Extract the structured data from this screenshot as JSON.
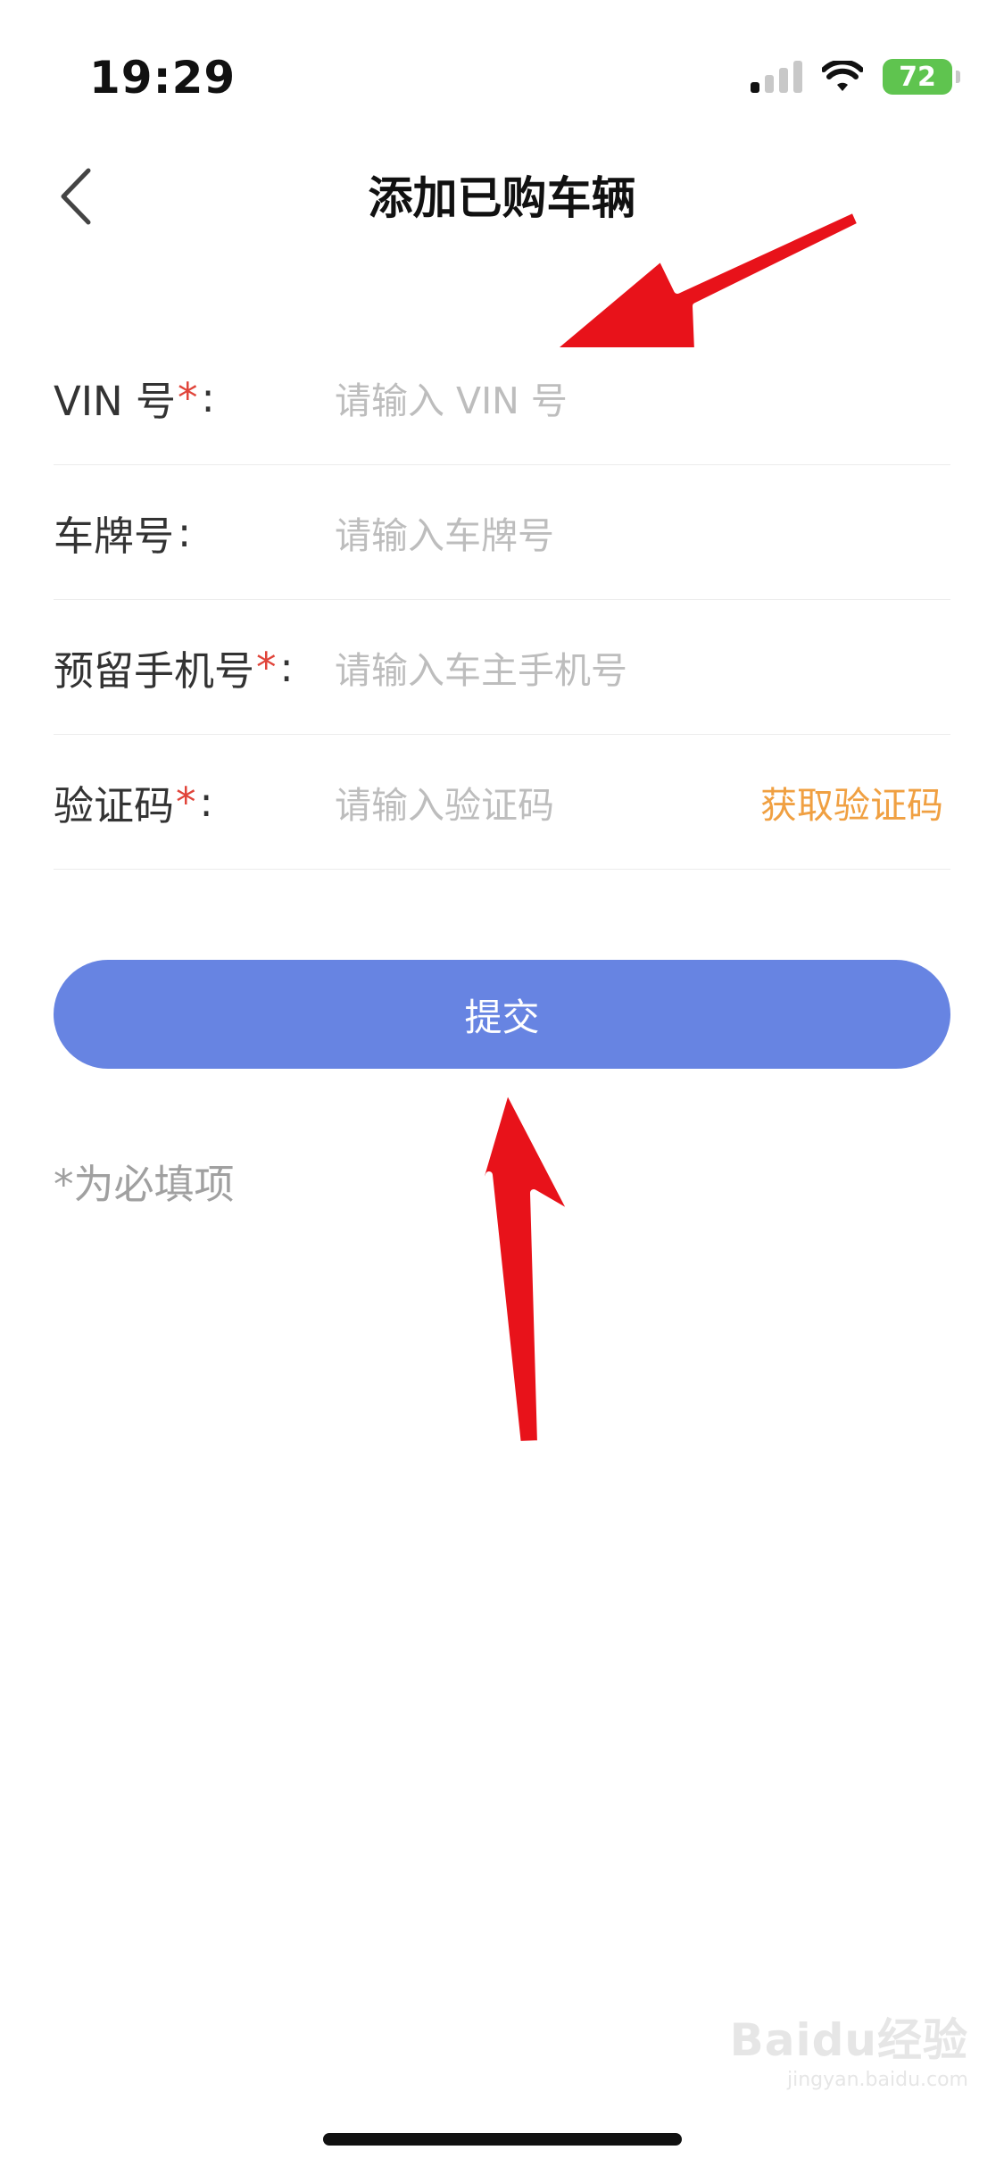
{
  "status_bar": {
    "time": "19:29",
    "battery": "72"
  },
  "header": {
    "title": "添加已购车辆"
  },
  "form": {
    "fields": [
      {
        "label": "VIN 号",
        "required": true,
        "colon": ":",
        "placeholder": "请输入 VIN 号"
      },
      {
        "label": "车牌号",
        "required": false,
        "colon": ":",
        "placeholder": "请输入车牌号"
      },
      {
        "label": "预留手机号",
        "required": true,
        "colon": ":",
        "placeholder": "请输入车主手机号"
      },
      {
        "label": "验证码",
        "required": true,
        "colon": ":",
        "placeholder": "请输入验证码"
      }
    ],
    "required_mark": "*",
    "get_code_label": "获取验证码",
    "submit_label": "提交",
    "required_note": "*为必填项"
  },
  "colors": {
    "primary": "#6784e2",
    "accent": "#f0a042",
    "required": "#e0443a",
    "battery": "#5fc44f"
  },
  "watermark": {
    "text": "Baidu经验",
    "sub": "jingyan.baidu.com"
  }
}
